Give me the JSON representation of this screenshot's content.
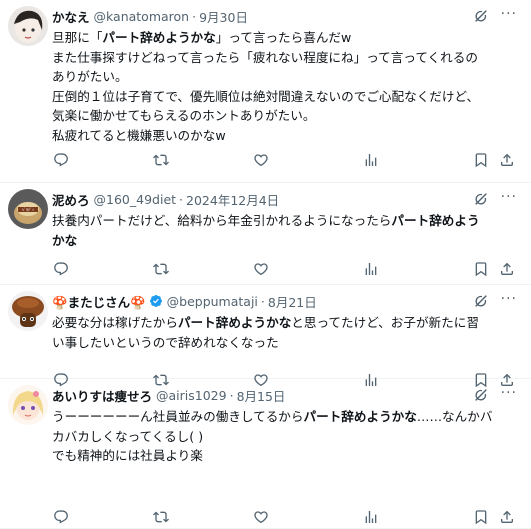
{
  "tweets": [
    {
      "name": "かなえ",
      "handle": "@kanatomaron",
      "date": "9月30日",
      "verified": false,
      "lines": [
        [
          {
            "t": "旦那に「"
          },
          {
            "t": "パート辞めようかな",
            "b": true
          },
          {
            "t": "」って言ったら喜んだw"
          }
        ],
        [
          {
            "t": "また仕事探すけどねって言ったら「疲れない程度にね」って言ってくれるの"
          }
        ],
        [
          {
            "t": "ありがたい。"
          }
        ],
        [
          {
            "t": "圧倒的１位は子育てで、優先順位は絶対間違えないのでご心配なくだけど、"
          }
        ],
        [
          {
            "t": "気楽に働かせてもらえるのホントありがたい。"
          }
        ],
        [
          {
            "t": "私疲れてると機嫌悪いのかなw"
          }
        ]
      ]
    },
    {
      "name": "泥めろ",
      "handle": "@160_49diet",
      "date": "2024年12月4日",
      "verified": false,
      "lines": [
        [
          {
            "t": "扶養内パートだけど、給料から年金引かれるようになったら"
          },
          {
            "t": "パート辞めよう",
            "b": true
          }
        ],
        [
          {
            "t": "かな",
            "b": true
          }
        ]
      ]
    },
    {
      "name": "🍄またじさん🍄",
      "handle": "@beppumataji",
      "date": "8月21日",
      "verified": true,
      "lines": [
        [
          {
            "t": "必要な分は稼げたから"
          },
          {
            "t": "パート辞めようかな",
            "b": true
          },
          {
            "t": "と思ってたけど、お子が新たに習"
          }
        ],
        [
          {
            "t": "い事したいというので辞めれなくなった"
          }
        ]
      ]
    },
    {
      "name": "あいりすは痩せろ",
      "handle": "@airis1029",
      "date": "8月15日",
      "verified": false,
      "lines": [
        [
          {
            "t": "うーーーーーーん社員並みの働きしてるから"
          },
          {
            "t": "パート辞めようかな",
            "b": true
          },
          {
            "t": "……なんかバ"
          }
        ],
        [
          {
            "t": "カバカしくなってくるし( )"
          }
        ],
        [
          {
            "t": "でも精神的には社員より楽"
          }
        ]
      ]
    }
  ],
  "icons": {
    "reply": "reply-icon",
    "retweet": "retweet-icon",
    "like": "like-icon",
    "views": "views-icon",
    "bookmark": "bookmark-icon",
    "share": "share-icon",
    "grok": "grok-icon",
    "more": "more-icon"
  },
  "colors": {
    "verified": "#1d9bf0",
    "secondary": "#536471",
    "text": "#0f1419",
    "divider": "#eff3f4"
  },
  "ui": {
    "more_glyph": "···"
  }
}
